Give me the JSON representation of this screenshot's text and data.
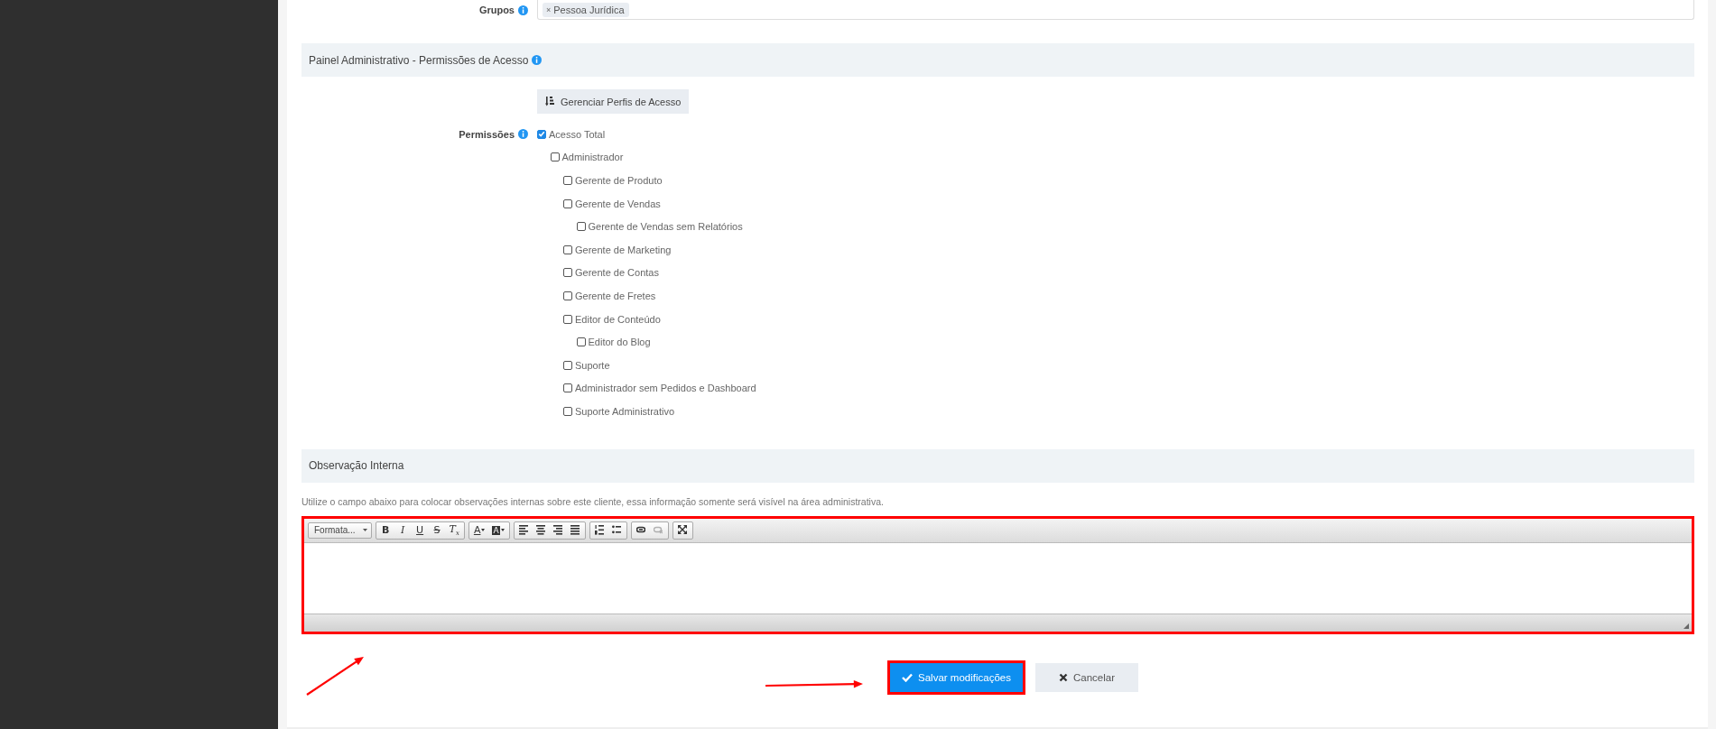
{
  "groups": {
    "label": "Grupos",
    "tags": [
      {
        "remove": "×",
        "label": "Pessoa Jurídica"
      }
    ]
  },
  "access_panel": {
    "title": "Painel Administrativo - Permissões de Acesso",
    "manage_button": "Gerenciar Perfis de Acesso",
    "permissions_label": "Permissões",
    "permissions": [
      {
        "label": "Acesso Total",
        "checked": true,
        "children": [
          {
            "label": "Administrador",
            "checked": false,
            "children": [
              {
                "label": "Gerente de Produto",
                "checked": false
              },
              {
                "label": "Gerente de Vendas",
                "checked": false,
                "children": [
                  {
                    "label": "Gerente de Vendas sem Relatórios",
                    "checked": false
                  }
                ]
              },
              {
                "label": "Gerente de Marketing",
                "checked": false
              },
              {
                "label": "Gerente de Contas",
                "checked": false
              },
              {
                "label": "Gerente de Fretes",
                "checked": false
              },
              {
                "label": "Editor de Conteúdo",
                "checked": false,
                "children": [
                  {
                    "label": "Editor do Blog",
                    "checked": false
                  }
                ]
              },
              {
                "label": "Suporte",
                "checked": false
              },
              {
                "label": "Administrador sem Pedidos e Dashboard",
                "checked": false
              },
              {
                "label": "Suporte Administrativo",
                "checked": false
              }
            ]
          }
        ]
      }
    ]
  },
  "notes": {
    "title": "Observação Interna",
    "help": "Utilize o campo abaixo para colocar observações internas sobre este cliente, essa informação somente será visível na área administrativa.",
    "editor": {
      "highlighted": true,
      "format": "Formata...",
      "toolbar": [
        [
          {
            "kind": "bold",
            "glyph": "B",
            "disabled": false
          },
          {
            "kind": "italic",
            "glyph": "I",
            "disabled": false
          },
          {
            "kind": "underline",
            "glyph": "U",
            "disabled": false
          },
          {
            "kind": "strike",
            "glyph": "S",
            "disabled": false
          },
          {
            "kind": "removeformat",
            "glyph": "T$_{x}$",
            "disabled": false
          }
        ],
        [
          {
            "kind": "textcolor",
            "glyph": "A",
            "disabled": false
          },
          {
            "kind": "bgcolor",
            "glyph": "A",
            "disabled": false
          }
        ],
        [
          {
            "kind": "alignleft",
            "disabled": false
          },
          {
            "kind": "aligncenter",
            "disabled": false
          },
          {
            "kind": "alignright",
            "disabled": false
          },
          {
            "kind": "justify",
            "disabled": false
          }
        ],
        [
          {
            "kind": "numberedlist",
            "disabled": false
          },
          {
            "kind": "bulletedlist",
            "disabled": false
          }
        ],
        [
          {
            "kind": "link",
            "disabled": false
          },
          {
            "kind": "unlink",
            "disabled": true
          }
        ],
        [
          {
            "kind": "maximize",
            "disabled": false
          }
        ]
      ]
    }
  },
  "actions": [
    {
      "kind": "save",
      "label": "Salvar modificações",
      "highlighted": true
    },
    {
      "kind": "cancel",
      "label": "Cancelar",
      "highlighted": false
    }
  ]
}
